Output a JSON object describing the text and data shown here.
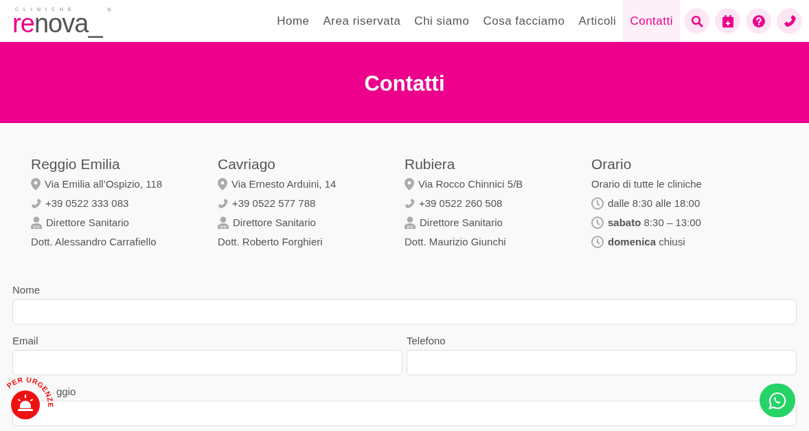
{
  "header": {
    "logo": {
      "top": "CLINICHE",
      "accent": "re",
      "rest": "nova_",
      "mark": "®"
    },
    "nav": [
      {
        "label": "Home",
        "selected": false
      },
      {
        "label": "Area riservata",
        "selected": false
      },
      {
        "label": "Chi siamo",
        "selected": false
      },
      {
        "label": "Cosa facciamo",
        "selected": false
      },
      {
        "label": "Articoli",
        "selected": false
      },
      {
        "label": "Contatti",
        "selected": true
      }
    ]
  },
  "banner": {
    "title": "Contatti"
  },
  "locations": [
    {
      "name": "Reggio Emilia",
      "address": "Via Emilia all’Ospizio, 118",
      "phone": "+39 0522 333 083",
      "role": "Direttore Sanitario",
      "doctor": "Dott. Alessandro Carrafiello"
    },
    {
      "name": "Cavriago",
      "address": "Via Ernesto Arduini, 14",
      "phone": "+39 0522 577 788",
      "role": "Direttore Sanitario",
      "doctor": "Dott. Roberto Forghieri"
    },
    {
      "name": "Rubiera",
      "address": "Via Rocco Chinnici 5/B",
      "phone": "+39 0522 260 508",
      "role": "Direttore Sanitario",
      "doctor": "Dott. Maurizio Giunchi"
    }
  ],
  "hours": {
    "title": "Orario",
    "subtitle": "Orario di tutte le cliniche",
    "items": [
      "dalle 8:30 alle 18:00",
      "**sabato** 8:30 – 13:00",
      "**domenica** chiusi"
    ]
  },
  "form": {
    "rows": [
      [
        {
          "label": "Nome"
        }
      ],
      [
        {
          "label": "Email"
        },
        {
          "label": "Telefono"
        }
      ],
      [
        {
          "label": "ggio"
        }
      ]
    ]
  },
  "urgent_badge": {
    "label": "PER URGENZE"
  }
}
